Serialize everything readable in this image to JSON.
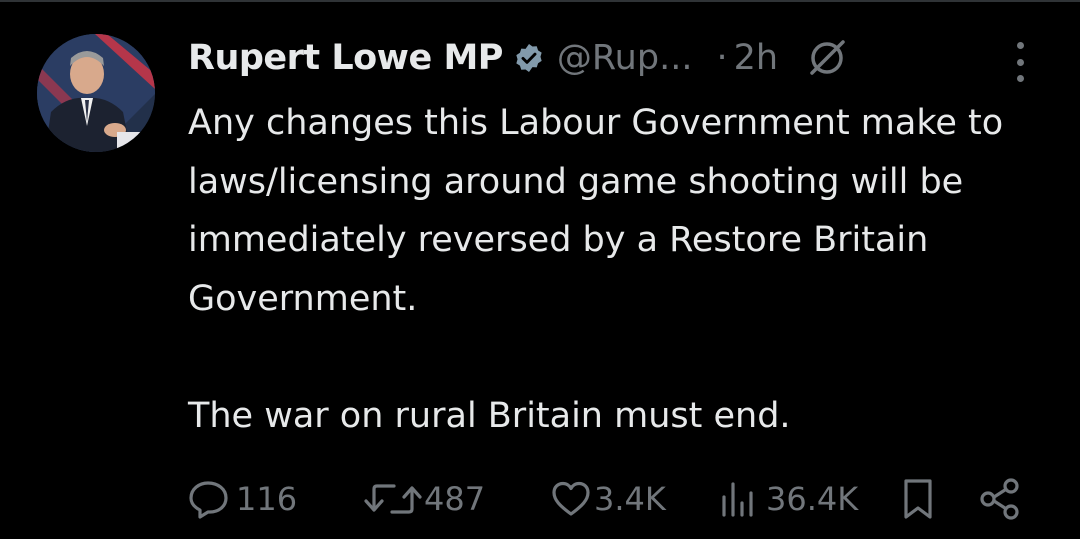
{
  "tweet": {
    "author_name": "Rupert Lowe MP",
    "handle": "@Rup...",
    "separator": "·",
    "time": "2h",
    "paragraphs": [
      "Any changes this Labour Government make to laws/licensing around game shooting will be immediately reversed by a Restore Britain Government.",
      "The war on rural Britain must end."
    ]
  },
  "actions": {
    "replies": "116",
    "reposts": "487",
    "likes": "3.4K",
    "views": "36.4K"
  },
  "icons": {
    "verified": "verified-badge-icon",
    "grok": "grok-icon",
    "more": "more-options-icon",
    "reply": "reply-icon",
    "repost": "repost-icon",
    "like": "like-icon",
    "views": "views-icon",
    "bookmark": "bookmark-icon",
    "share": "share-icon"
  },
  "colors": {
    "background": "#000000",
    "text": "#e7e9ea",
    "muted": "#71767b",
    "verified": "#829aab"
  }
}
